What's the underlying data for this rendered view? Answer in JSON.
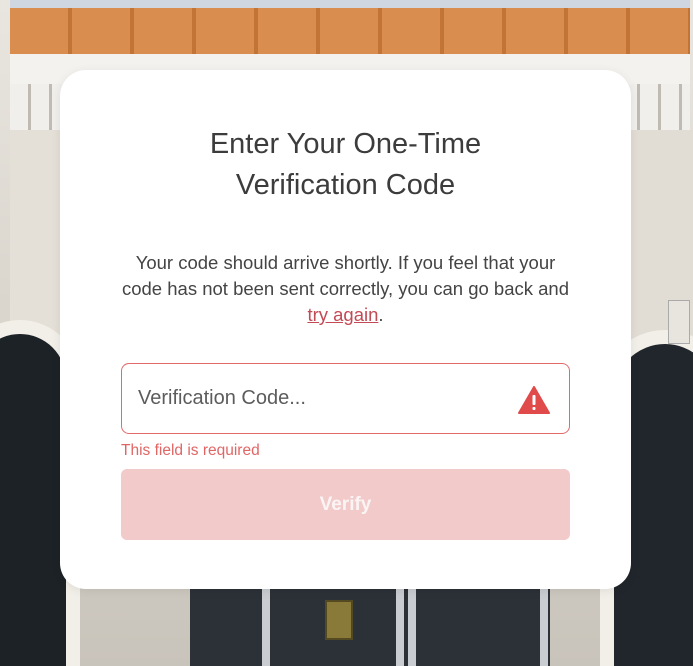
{
  "modal": {
    "title_line1": "Enter Your One-Time",
    "title_line2": "Verification Code",
    "description_before_link": "Your code should arrive shortly. If you feel that your code has not been sent correctly, you can go back and ",
    "try_again_link": "try again",
    "description_after_link": ".",
    "code_field": {
      "placeholder": "Verification Code...",
      "value": "",
      "status_icon": "warning-triangle-icon"
    },
    "error_message": "This field is required",
    "verify_button": "Verify"
  },
  "colors": {
    "accent": "#c24a55",
    "error": "#e06666",
    "button_disabled": "#f2caca",
    "card": "#ffffff"
  }
}
